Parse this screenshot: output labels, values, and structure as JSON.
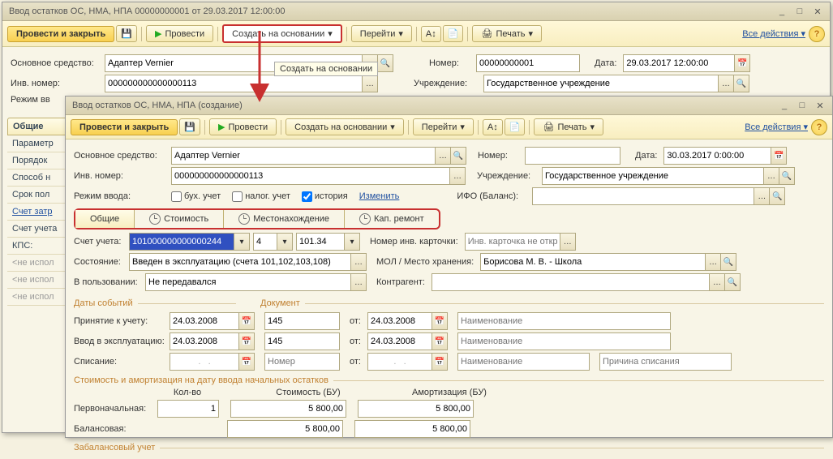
{
  "bg": {
    "title": "Ввод остатков ОС, НМА, НПА 00000000001 от 29.03.2017 12:00:00",
    "toolbar": {
      "post_close": "Провести и закрыть",
      "post": "Провести",
      "create_from": "Создать на основании",
      "goto": "Перейти",
      "print": "Печать",
      "all_actions": "Все действия"
    },
    "labels": {
      "asset": "Основное средство:",
      "inv_no": "Инв. номер:",
      "mode": "Режим вв",
      "number": "Номер:",
      "date": "Дата:",
      "org": "Учреждение:"
    },
    "values": {
      "asset": "Адаптер Vernier",
      "inv_no": "000000000000000113",
      "number": "00000000001",
      "date": "29.03.2017 12:00:00",
      "org": "Государственное учреждение"
    },
    "tooltip": "Создать на основании",
    "side_tabs": [
      "Общие",
      "Параметр",
      "Порядок",
      "Способ н",
      "Срок пол",
      "Счет затр",
      "Счет учета",
      "КПС:",
      "<не испол",
      "<не испол",
      "<не испол"
    ]
  },
  "fg": {
    "title": "Ввод остатков ОС, НМА, НПА (создание)",
    "toolbar": {
      "post_close": "Провести и закрыть",
      "post": "Провести",
      "create_from": "Создать на основании",
      "goto": "Перейти",
      "print": "Печать",
      "all_actions": "Все действия"
    },
    "labels": {
      "asset": "Основное средство:",
      "inv_no": "Инв. номер:",
      "mode": "Режим ввода:",
      "number": "Номер:",
      "date": "Дата:",
      "org": "Учреждение:",
      "ifo": "ИФО (Баланс):",
      "account": "Счет учета:",
      "inv_card": "Номер инв. карточки:",
      "state": "Состояние:",
      "mol": "МОЛ / Место хранения:",
      "in_use": "В пользовании:",
      "counterparty": "Контрагент:",
      "events_dates": "Даты событий",
      "document": "Документ",
      "accept": "Принятие к учету:",
      "commission": "Ввод в эксплуатацию:",
      "writeoff": "Списание:",
      "from": "от:",
      "placeholder_name": "Наименование",
      "placeholder_num": "Номер",
      "placeholder_reason": "Причина списания",
      "placeholder_card": "Инв. карточка не откры...",
      "amort_section": "Стоимость и амортизация на дату ввода начальных остатков",
      "qty": "Кол-во",
      "cost_bu": "Стоимость (БУ)",
      "amort_bu": "Амортизация (БУ)",
      "initial": "Первоначальная:",
      "balance": "Балансовая:",
      "offbalance": "Забалансовый учет"
    },
    "values": {
      "asset": "Адаптер Vernier",
      "inv_no": "000000000000000113",
      "date": "30.03.2017 0:00:00",
      "org": "Государственное учреждение",
      "account": "101000000000000244",
      "acc_sub1": "4",
      "acc_sub2": "101.34",
      "state": "Введен в эксплуатацию (счета 101,102,103,108)",
      "mol": "Борисова М. В. - Школа",
      "in_use": "Не передавался",
      "accept_date": "24.03.2008",
      "accept_doc": "145",
      "accept_from": "24.03.2008",
      "comm_date": "24.03.2008",
      "comm_doc": "145",
      "comm_from": "24.03.2008",
      "qty": "1",
      "cost_initial": "5 800,00",
      "amort_initial": "5 800,00",
      "cost_balance": "5 800,00",
      "amort_balance": "5 800,00"
    },
    "mode_checks": {
      "buh": "бух. учет",
      "tax": "налог. учет",
      "hist": "история",
      "change": "Изменить"
    },
    "subtabs": [
      "Общие",
      "Стоимость",
      "Местонахождение",
      "Кап. ремонт"
    ]
  }
}
